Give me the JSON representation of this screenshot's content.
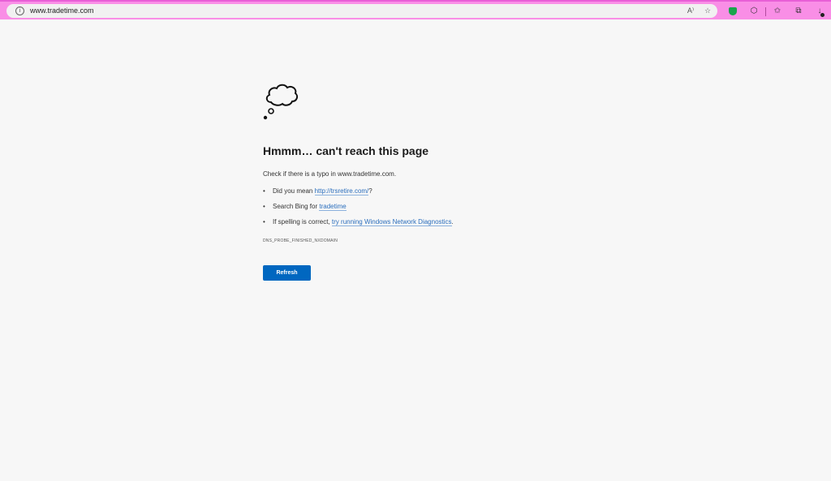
{
  "browser": {
    "url": "www.tradetime.com",
    "icons": [
      "info-icon",
      "read-aloud-icon",
      "add-favorite-icon",
      "shield-icon",
      "extensions-icon",
      "favorites-icon",
      "collections-icon",
      "downloads-icon"
    ],
    "glyphs": {
      "info": "i",
      "read_aloud": "A⁾",
      "add_favorite": "☆",
      "extensions": "⬡",
      "favorites": "✩",
      "collections": "⧉",
      "downloads": "↓"
    },
    "accent_color": "#f98ee6"
  },
  "error_page": {
    "heading": "Hmmm… can't reach this page",
    "check_text": "Check if there is a typo in www.tradetime.com.",
    "suggestions": [
      {
        "prefix": "Did you mean ",
        "link": "http://trsretire.com/",
        "suffix": "?"
      },
      {
        "prefix": "Search Bing for ",
        "link": "tradetime",
        "suffix": ""
      },
      {
        "prefix": "If spelling is correct, ",
        "link": "try running Windows Network Diagnostics",
        "suffix": "."
      }
    ],
    "bullet": "•",
    "error_code": "DNS_PROBE_FINISHED_NXDOMAIN",
    "refresh_label": "Refresh",
    "button_color": "#0067c0",
    "link_color": "#2a6ebd"
  }
}
